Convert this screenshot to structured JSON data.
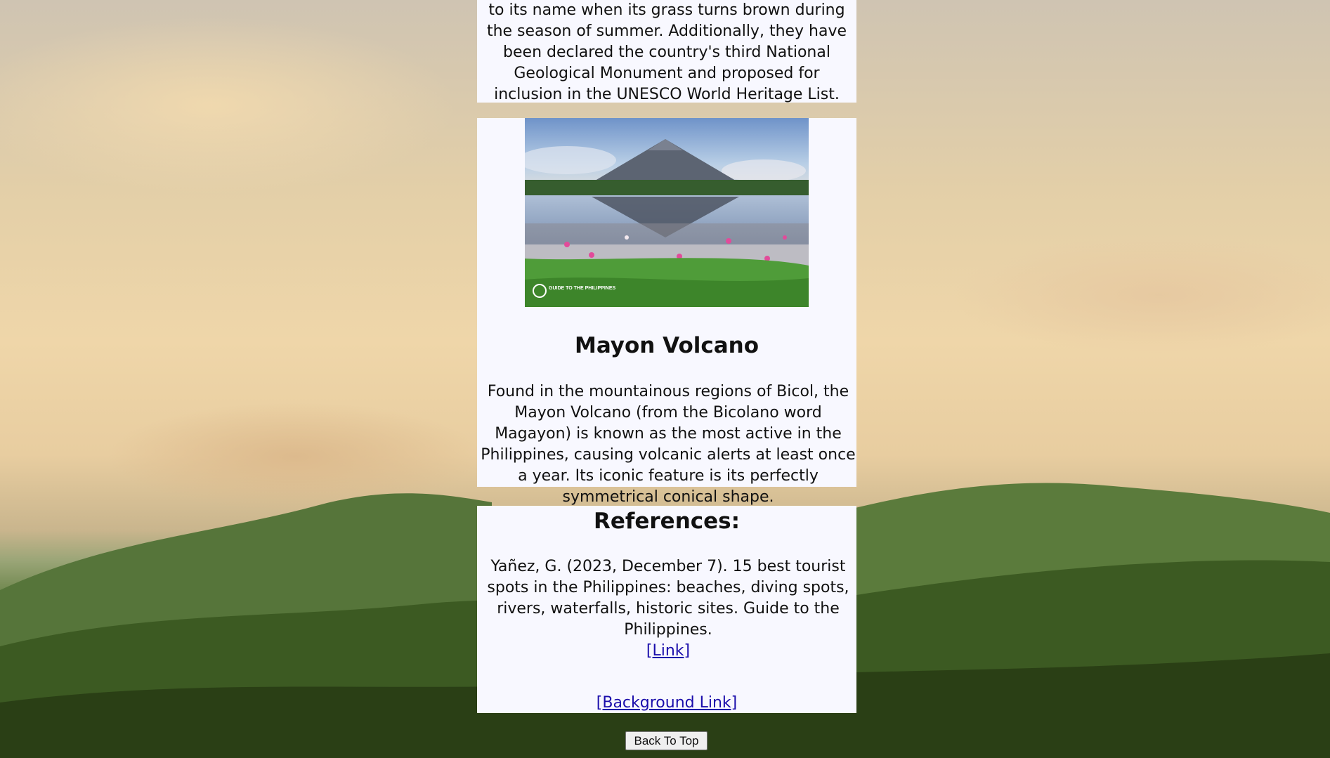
{
  "sections": {
    "previous_description": "to its name when its grass turns brown during the season of summer. Additionally, they have been declared the country's third National Geological Monument and proposed for inclusion in the UNESCO World Heritage List.",
    "mayon": {
      "image_watermark": "GUIDE TO THE PHILIPPINES",
      "title": "Mayon Volcano",
      "description": "Found in the mountainous regions of Bicol, the Mayon Volcano (from the Bicolano word Magayon) is known as the most active in the Philippines, causing volcanic alerts at least once a year. Its iconic feature is its perfectly symmetrical conical shape."
    }
  },
  "references": {
    "title": "References:",
    "citation": "Yañez, G. (2023, December 7). 15 best tourist spots in the Philippines: beaches, diving spots, rivers, waterfalls, historic sites. Guide to the Philippines.",
    "link_label": "[Link]",
    "background_link_label": "[Background Link]"
  },
  "back_to_top_label": "Back To Top",
  "colors": {
    "card_background": "#f8f8ff",
    "link": "#1a0dab"
  }
}
